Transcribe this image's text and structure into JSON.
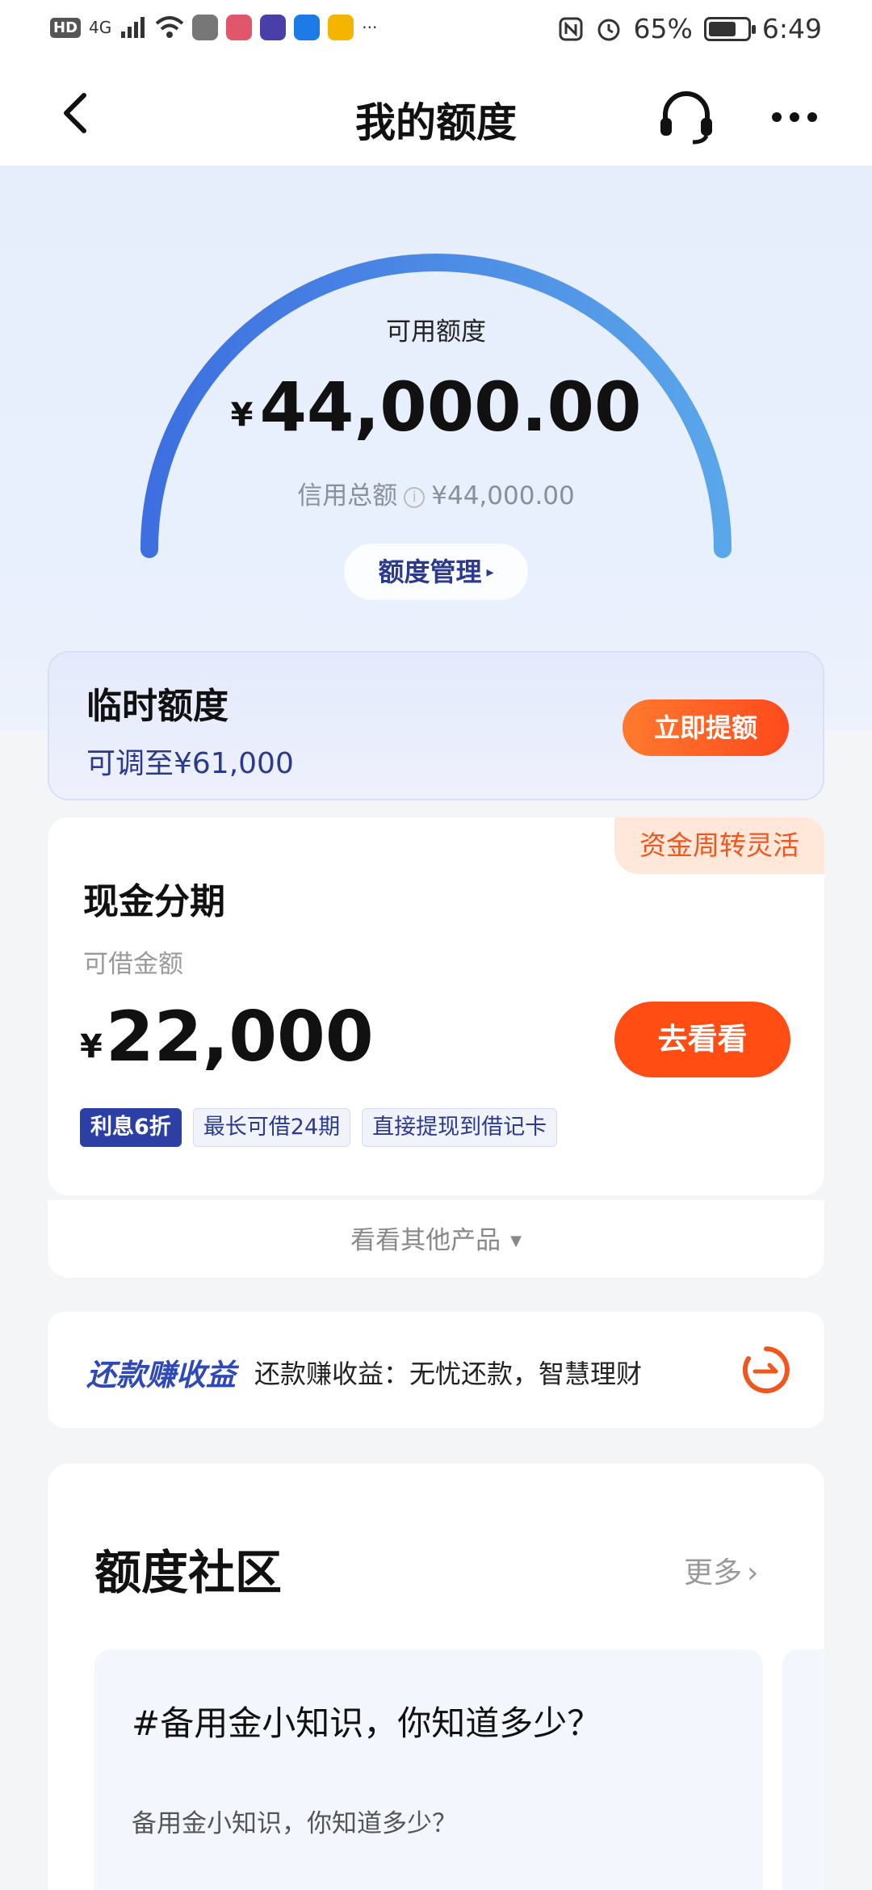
{
  "status_bar": {
    "left_badge_hd": "HD",
    "network": "4G",
    "more_notifications": "···",
    "battery": "65%",
    "time": "6:49"
  },
  "nav": {
    "title": "我的额度",
    "back_icon": "chevron-left-icon",
    "support_icon": "headset-icon",
    "more_icon": "more-horizontal-icon"
  },
  "hero": {
    "available_label": "可用额度",
    "currency": "¥",
    "available_amount": "44,000.00",
    "total_label": "信用总额",
    "total_amount": "¥44,000.00",
    "manage_label": "额度管理",
    "manage_arrow": "▸",
    "gauge_fill_fraction": 1.0,
    "gauge_color_start": "#3d6fe0",
    "gauge_color_end": "#5aa6ea"
  },
  "temp_quota": {
    "title": "临时额度",
    "subtitle": "可调至¥61,000",
    "button": "立即提额"
  },
  "cash": {
    "corner_tag": "资金周转灵活",
    "title": "现金分期",
    "amount_label": "可借金额",
    "currency": "¥",
    "amount": "22,000",
    "button": "去看看",
    "tags": [
      "利息6折",
      "最长可借24期",
      "直接提现到借记卡"
    ]
  },
  "other_products": {
    "label": "看看其他产品",
    "arrow": "▼"
  },
  "repay": {
    "logo": "还款赚收益",
    "text": "还款赚收益：无忧还款，智慧理财"
  },
  "community": {
    "title": "额度社区",
    "more": "更多",
    "more_chevron": "›",
    "post": {
      "title": "#备用金小知识，你知道多少？",
      "desc": "备用金小知识，你知道多少？"
    }
  },
  "colors": {
    "accent_orange": "#ff4d14",
    "brand_blue": "#2c3fa4"
  }
}
